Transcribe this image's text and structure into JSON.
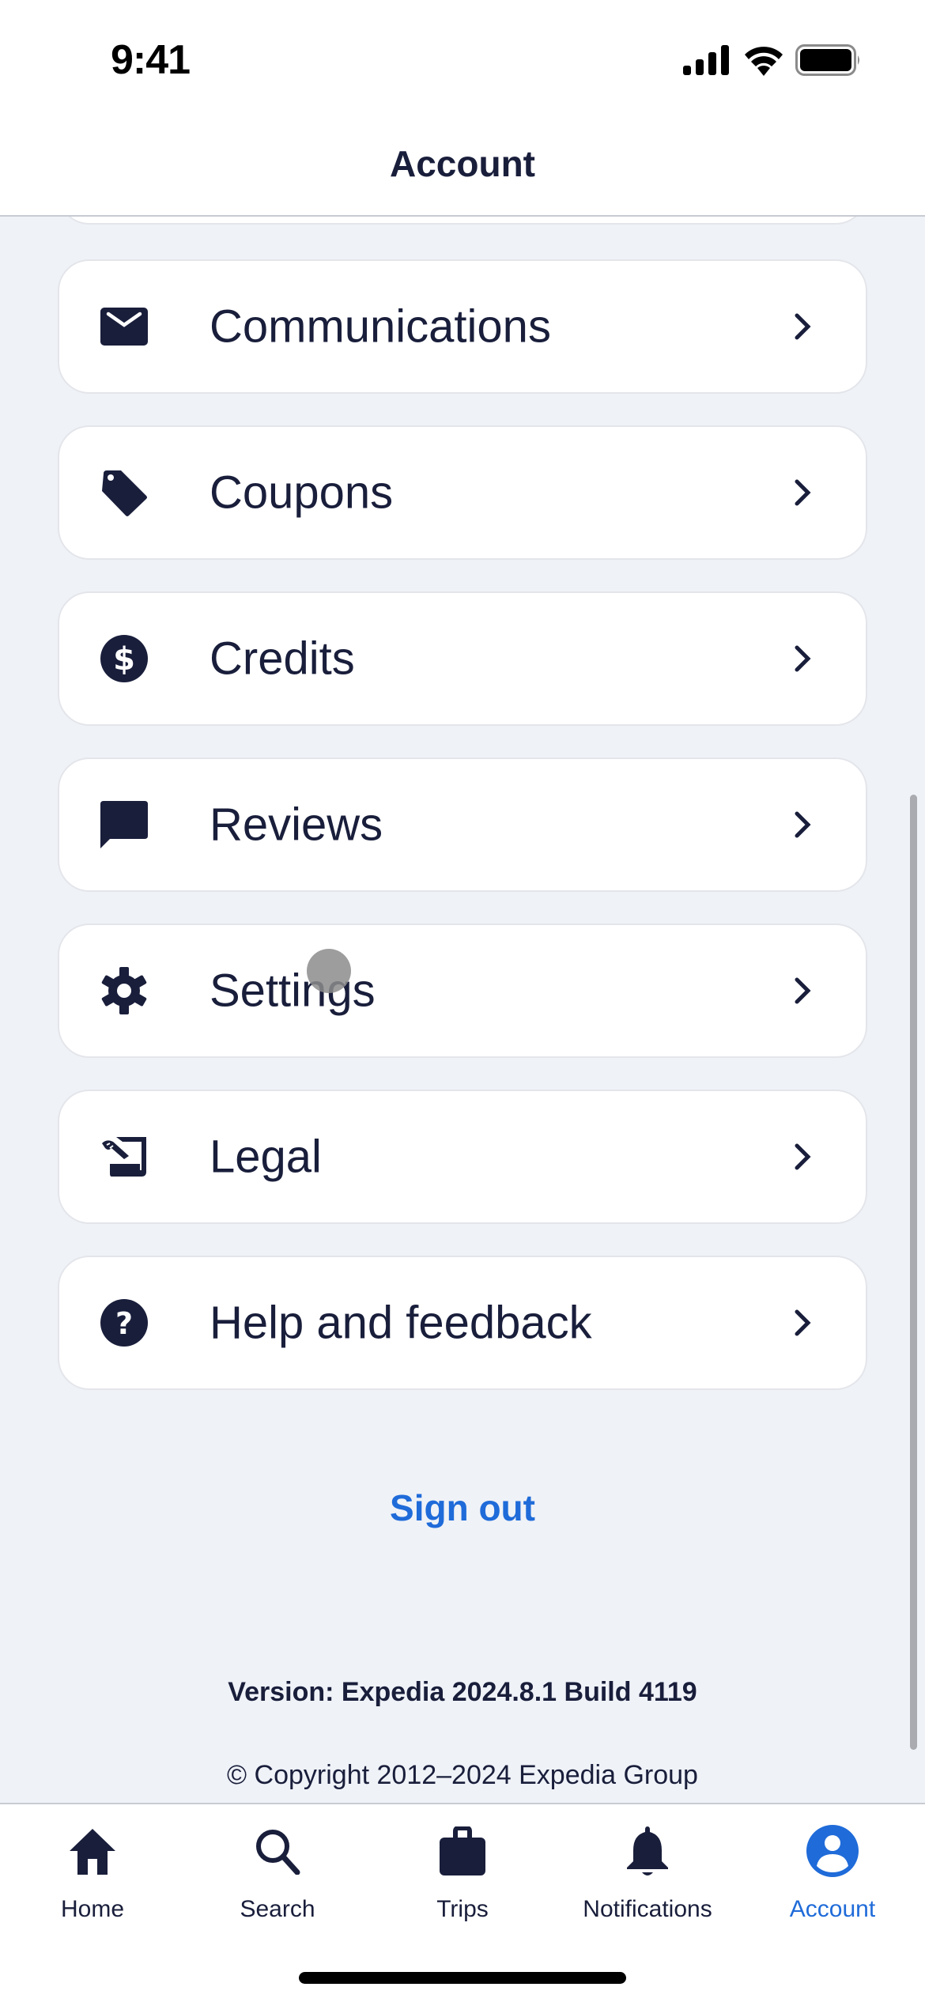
{
  "status_bar": {
    "time": "9:41"
  },
  "header": {
    "title": "Account"
  },
  "menu": {
    "items": [
      {
        "label": "Communications",
        "icon": "envelope-icon"
      },
      {
        "label": "Coupons",
        "icon": "tag-icon"
      },
      {
        "label": "Credits",
        "icon": "dollar-circle-icon"
      },
      {
        "label": "Reviews",
        "icon": "chat-bubble-icon"
      },
      {
        "label": "Settings",
        "icon": "gear-icon"
      },
      {
        "label": "Legal",
        "icon": "legal-document-icon"
      },
      {
        "label": "Help and feedback",
        "icon": "question-circle-icon"
      }
    ]
  },
  "sign_out": {
    "label": "Sign out"
  },
  "footer": {
    "version": "Version: Expedia 2024.8.1 Build 4119",
    "copyright": "© Copyright 2012–2024 Expedia Group"
  },
  "tab_bar": {
    "tabs": [
      {
        "label": "Home",
        "icon": "home-icon",
        "active": false
      },
      {
        "label": "Search",
        "icon": "search-icon",
        "active": false
      },
      {
        "label": "Trips",
        "icon": "briefcase-icon",
        "active": false
      },
      {
        "label": "Notifications",
        "icon": "bell-icon",
        "active": false
      },
      {
        "label": "Account",
        "icon": "account-icon",
        "active": true
      }
    ]
  },
  "colors": {
    "text": "#191e3b",
    "accent": "#1f6bd9",
    "background": "#eff2f7",
    "card": "#ffffff"
  }
}
